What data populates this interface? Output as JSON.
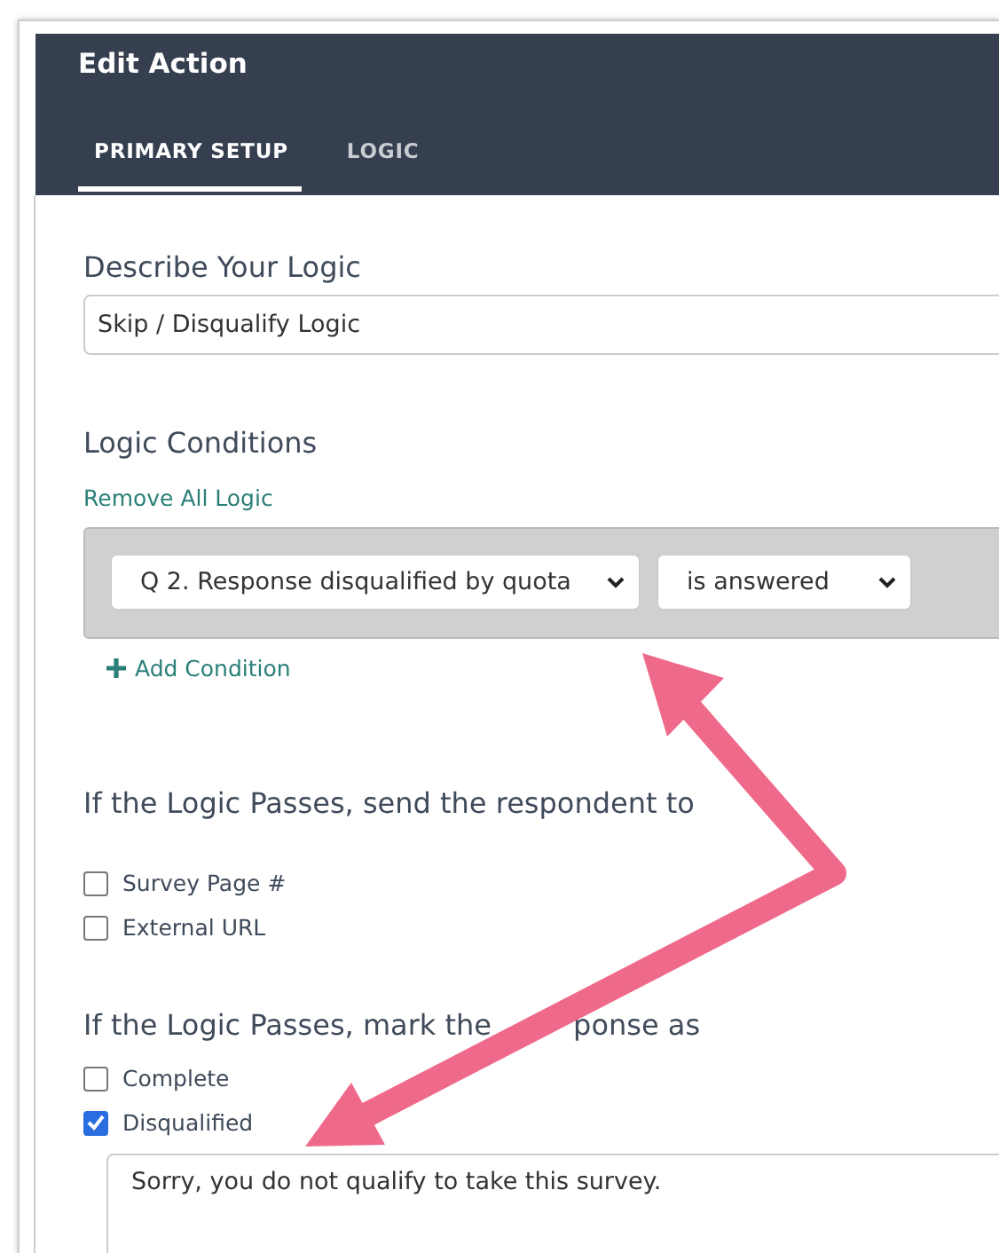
{
  "window": {
    "title": "Edit Action"
  },
  "tabs": [
    {
      "label": "PRIMARY SETUP",
      "selected": true
    },
    {
      "label": "LOGIC",
      "selected": false
    }
  ],
  "describe": {
    "label": "Describe Your Logic",
    "value": "Skip / Disqualify Logic"
  },
  "conditions": {
    "heading": "Logic Conditions",
    "remove_link": "Remove All Logic",
    "rows": [
      {
        "question": "Q 2. Response disqualified by quota",
        "operator": "is answered"
      }
    ],
    "add_link": "Add Condition"
  },
  "send_to": {
    "heading": "If the Logic Passes, send the respondent to",
    "options": [
      {
        "label": "Survey Page #",
        "checked": false
      },
      {
        "label": "External URL",
        "checked": false
      }
    ]
  },
  "mark_as": {
    "heading_parts": [
      "If the Logic Passes, mark the",
      "ponse as"
    ],
    "options": [
      {
        "label": "Complete",
        "checked": false
      },
      {
        "label": "Disqualified",
        "checked": true
      }
    ],
    "message": "Sorry, you do not qualify to take this survey."
  }
}
